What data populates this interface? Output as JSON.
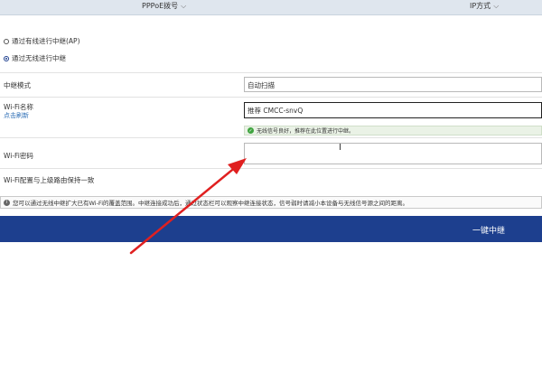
{
  "topbar": {
    "pppoe_label": "PPPoE拨号",
    "ip_label": "IP方式"
  },
  "relay_options": {
    "wired_label": "通过有线进行中继(AP)",
    "wireless_label": "通过无线进行中继"
  },
  "form": {
    "mode_label": "中继模式",
    "mode_value": "自动扫描",
    "wifi_name_label": "Wi-Fi名称",
    "refresh_link": "点击刷新",
    "wifi_name_value": "推荐  CMCC-snvQ",
    "signal_hint": "无线信号良好，推荐在此位置进行中继。",
    "wifi_password_label": "Wi-Fi密码",
    "wifi_password_value": "",
    "sync_label": "Wi-Fi配置与上级路由保持一致"
  },
  "notice": {
    "text": "您可以通过无线中继扩大已有Wi-Fi的覆盖范围。中继连接成功后，通过状态栏可以观察中继连接状态，信号弱时请减小本设备与无线信号源之间的距离。"
  },
  "actions": {
    "relay_button": "一键中继"
  },
  "colors": {
    "primary": "#1d3f8e",
    "link": "#2f6fb6",
    "success": "#3fa43f",
    "annotation_arrow": "#e02020"
  },
  "icons": {
    "chevron": "chevron-down-icon",
    "check": "check-circle-icon",
    "info": "info-icon",
    "text_cursor": "text-cursor-icon",
    "annotation": "red-arrow-icon"
  }
}
